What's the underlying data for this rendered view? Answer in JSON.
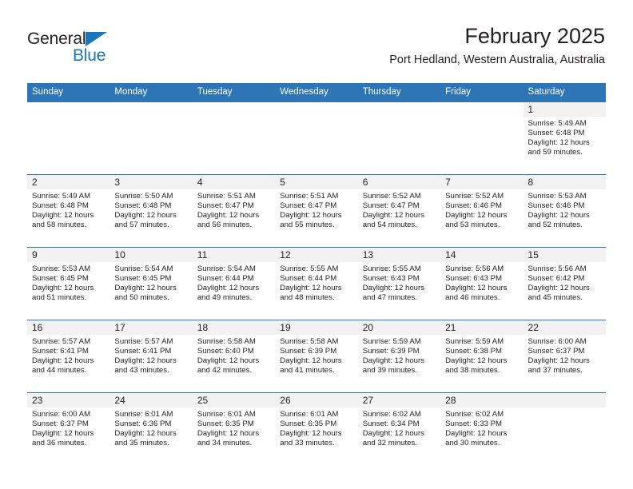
{
  "brand": {
    "name_top": "General",
    "name_bottom": "Blue",
    "triangle_color": "#1b75bb",
    "blue_color": "#1b75bb"
  },
  "header": {
    "title": "February 2025",
    "subtitle": "Port Hedland, Western Australia, Australia"
  },
  "theme": {
    "header_row_bg": "#2e75b6",
    "header_row_text": "#ffffff",
    "daynum_band_bg": "#f2f2f2",
    "row_divider": "#2e75b6",
    "body_text": "#231f20"
  },
  "weekday_headers": [
    "Sunday",
    "Monday",
    "Tuesday",
    "Wednesday",
    "Thursday",
    "Friday",
    "Saturday"
  ],
  "labels": {
    "sunrise_prefix": "Sunrise:",
    "sunset_prefix": "Sunset:",
    "daylight_prefix": "Daylight:"
  },
  "weeks": [
    [
      {
        "blank": true
      },
      {
        "blank": true
      },
      {
        "blank": true
      },
      {
        "blank": true
      },
      {
        "blank": true
      },
      {
        "blank": true
      },
      {
        "day": "1",
        "sunrise": "Sunrise: 5:49 AM",
        "sunset": "Sunset: 6:48 PM",
        "daylight_line1": "Daylight: 12 hours",
        "daylight_line2": "and 59 minutes."
      }
    ],
    [
      {
        "day": "2",
        "sunrise": "Sunrise: 5:49 AM",
        "sunset": "Sunset: 6:48 PM",
        "daylight_line1": "Daylight: 12 hours",
        "daylight_line2": "and 58 minutes."
      },
      {
        "day": "3",
        "sunrise": "Sunrise: 5:50 AM",
        "sunset": "Sunset: 6:48 PM",
        "daylight_line1": "Daylight: 12 hours",
        "daylight_line2": "and 57 minutes."
      },
      {
        "day": "4",
        "sunrise": "Sunrise: 5:51 AM",
        "sunset": "Sunset: 6:47 PM",
        "daylight_line1": "Daylight: 12 hours",
        "daylight_line2": "and 56 minutes."
      },
      {
        "day": "5",
        "sunrise": "Sunrise: 5:51 AM",
        "sunset": "Sunset: 6:47 PM",
        "daylight_line1": "Daylight: 12 hours",
        "daylight_line2": "and 55 minutes."
      },
      {
        "day": "6",
        "sunrise": "Sunrise: 5:52 AM",
        "sunset": "Sunset: 6:47 PM",
        "daylight_line1": "Daylight: 12 hours",
        "daylight_line2": "and 54 minutes."
      },
      {
        "day": "7",
        "sunrise": "Sunrise: 5:52 AM",
        "sunset": "Sunset: 6:46 PM",
        "daylight_line1": "Daylight: 12 hours",
        "daylight_line2": "and 53 minutes."
      },
      {
        "day": "8",
        "sunrise": "Sunrise: 5:53 AM",
        "sunset": "Sunset: 6:46 PM",
        "daylight_line1": "Daylight: 12 hours",
        "daylight_line2": "and 52 minutes."
      }
    ],
    [
      {
        "day": "9",
        "sunrise": "Sunrise: 5:53 AM",
        "sunset": "Sunset: 6:45 PM",
        "daylight_line1": "Daylight: 12 hours",
        "daylight_line2": "and 51 minutes."
      },
      {
        "day": "10",
        "sunrise": "Sunrise: 5:54 AM",
        "sunset": "Sunset: 6:45 PM",
        "daylight_line1": "Daylight: 12 hours",
        "daylight_line2": "and 50 minutes."
      },
      {
        "day": "11",
        "sunrise": "Sunrise: 5:54 AM",
        "sunset": "Sunset: 6:44 PM",
        "daylight_line1": "Daylight: 12 hours",
        "daylight_line2": "and 49 minutes."
      },
      {
        "day": "12",
        "sunrise": "Sunrise: 5:55 AM",
        "sunset": "Sunset: 6:44 PM",
        "daylight_line1": "Daylight: 12 hours",
        "daylight_line2": "and 48 minutes."
      },
      {
        "day": "13",
        "sunrise": "Sunrise: 5:55 AM",
        "sunset": "Sunset: 6:43 PM",
        "daylight_line1": "Daylight: 12 hours",
        "daylight_line2": "and 47 minutes."
      },
      {
        "day": "14",
        "sunrise": "Sunrise: 5:56 AM",
        "sunset": "Sunset: 6:43 PM",
        "daylight_line1": "Daylight: 12 hours",
        "daylight_line2": "and 46 minutes."
      },
      {
        "day": "15",
        "sunrise": "Sunrise: 5:56 AM",
        "sunset": "Sunset: 6:42 PM",
        "daylight_line1": "Daylight: 12 hours",
        "daylight_line2": "and 45 minutes."
      }
    ],
    [
      {
        "day": "16",
        "sunrise": "Sunrise: 5:57 AM",
        "sunset": "Sunset: 6:41 PM",
        "daylight_line1": "Daylight: 12 hours",
        "daylight_line2": "and 44 minutes."
      },
      {
        "day": "17",
        "sunrise": "Sunrise: 5:57 AM",
        "sunset": "Sunset: 6:41 PM",
        "daylight_line1": "Daylight: 12 hours",
        "daylight_line2": "and 43 minutes."
      },
      {
        "day": "18",
        "sunrise": "Sunrise: 5:58 AM",
        "sunset": "Sunset: 6:40 PM",
        "daylight_line1": "Daylight: 12 hours",
        "daylight_line2": "and 42 minutes."
      },
      {
        "day": "19",
        "sunrise": "Sunrise: 5:58 AM",
        "sunset": "Sunset: 6:39 PM",
        "daylight_line1": "Daylight: 12 hours",
        "daylight_line2": "and 41 minutes."
      },
      {
        "day": "20",
        "sunrise": "Sunrise: 5:59 AM",
        "sunset": "Sunset: 6:39 PM",
        "daylight_line1": "Daylight: 12 hours",
        "daylight_line2": "and 39 minutes."
      },
      {
        "day": "21",
        "sunrise": "Sunrise: 5:59 AM",
        "sunset": "Sunset: 6:38 PM",
        "daylight_line1": "Daylight: 12 hours",
        "daylight_line2": "and 38 minutes."
      },
      {
        "day": "22",
        "sunrise": "Sunrise: 6:00 AM",
        "sunset": "Sunset: 6:37 PM",
        "daylight_line1": "Daylight: 12 hours",
        "daylight_line2": "and 37 minutes."
      }
    ],
    [
      {
        "day": "23",
        "sunrise": "Sunrise: 6:00 AM",
        "sunset": "Sunset: 6:37 PM",
        "daylight_line1": "Daylight: 12 hours",
        "daylight_line2": "and 36 minutes."
      },
      {
        "day": "24",
        "sunrise": "Sunrise: 6:01 AM",
        "sunset": "Sunset: 6:36 PM",
        "daylight_line1": "Daylight: 12 hours",
        "daylight_line2": "and 35 minutes."
      },
      {
        "day": "25",
        "sunrise": "Sunrise: 6:01 AM",
        "sunset": "Sunset: 6:35 PM",
        "daylight_line1": "Daylight: 12 hours",
        "daylight_line2": "and 34 minutes."
      },
      {
        "day": "26",
        "sunrise": "Sunrise: 6:01 AM",
        "sunset": "Sunset: 6:35 PM",
        "daylight_line1": "Daylight: 12 hours",
        "daylight_line2": "and 33 minutes."
      },
      {
        "day": "27",
        "sunrise": "Sunrise: 6:02 AM",
        "sunset": "Sunset: 6:34 PM",
        "daylight_line1": "Daylight: 12 hours",
        "daylight_line2": "and 32 minutes."
      },
      {
        "day": "28",
        "sunrise": "Sunrise: 6:02 AM",
        "sunset": "Sunset: 6:33 PM",
        "daylight_line1": "Daylight: 12 hours",
        "daylight_line2": "and 30 minutes."
      },
      {
        "empty": true
      }
    ]
  ]
}
